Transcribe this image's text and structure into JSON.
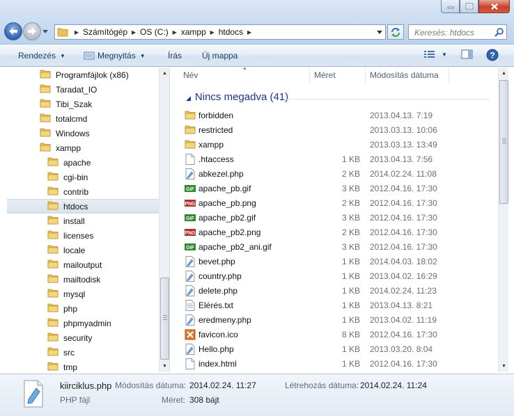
{
  "window": {
    "minimize_icon": "minimize-icon",
    "maximize_icon": "maximize-icon",
    "close_icon": "close-icon"
  },
  "address": {
    "crumbs": [
      "Számítógép",
      "OS (C:)",
      "xampp",
      "htdocs"
    ]
  },
  "search": {
    "placeholder": "Keresés: htdocs"
  },
  "toolbar": {
    "organize": "Rendezés",
    "open": "Megnyitás",
    "burn": "Írás",
    "new_folder": "Új mappa"
  },
  "tree": {
    "items": [
      {
        "label": "Programfájlok (x86)",
        "level": 1
      },
      {
        "label": "Taradat_IO",
        "level": 1
      },
      {
        "label": "Tibi_Szak",
        "level": 1
      },
      {
        "label": "totalcmd",
        "level": 1
      },
      {
        "label": "Windows",
        "level": 1
      },
      {
        "label": "xampp",
        "level": 1
      },
      {
        "label": "apache",
        "level": 2
      },
      {
        "label": "cgi-bin",
        "level": 2
      },
      {
        "label": "contrib",
        "level": 2
      },
      {
        "label": "htdocs",
        "level": 2,
        "selected": true
      },
      {
        "label": "install",
        "level": 2
      },
      {
        "label": "licenses",
        "level": 2
      },
      {
        "label": "locale",
        "level": 2
      },
      {
        "label": "mailoutput",
        "level": 2
      },
      {
        "label": "mailtodisk",
        "level": 2
      },
      {
        "label": "mysql",
        "level": 2
      },
      {
        "label": "php",
        "level": 2
      },
      {
        "label": "phpmyadmin",
        "level": 2
      },
      {
        "label": "security",
        "level": 2
      },
      {
        "label": "src",
        "level": 2
      },
      {
        "label": "tmp",
        "level": 2
      }
    ]
  },
  "list": {
    "columns": {
      "name": "Név",
      "size": "Méret",
      "modified": "Módosítás dátuma"
    },
    "group": "Nincs megadva (41)",
    "rows": [
      {
        "name": "forbidden",
        "size": "",
        "date": "2013.04.13. 7:19",
        "icon": "folder"
      },
      {
        "name": "restricted",
        "size": "",
        "date": "2013.03.13. 10:06",
        "icon": "folder"
      },
      {
        "name": "xampp",
        "size": "",
        "date": "2013.03.13. 13:49",
        "icon": "folder"
      },
      {
        "name": ".htaccess",
        "size": "1 KB",
        "date": "2013.04.13. 7:56",
        "icon": "file"
      },
      {
        "name": "abkezel.php",
        "size": "2 KB",
        "date": "2014.02.24. 11:08",
        "icon": "php"
      },
      {
        "name": "apache_pb.gif",
        "size": "3 KB",
        "date": "2012.04.16. 17:30",
        "icon": "gif"
      },
      {
        "name": "apache_pb.png",
        "size": "2 KB",
        "date": "2012.04.16. 17:30",
        "icon": "png"
      },
      {
        "name": "apache_pb2.gif",
        "size": "3 KB",
        "date": "2012.04.16. 17:30",
        "icon": "gif"
      },
      {
        "name": "apache_pb2.png",
        "size": "2 KB",
        "date": "2012.04.16. 17:30",
        "icon": "png"
      },
      {
        "name": "apache_pb2_ani.gif",
        "size": "3 KB",
        "date": "2012.04.16. 17:30",
        "icon": "gif"
      },
      {
        "name": "bevet.php",
        "size": "1 KB",
        "date": "2014.04.03. 18:02",
        "icon": "php"
      },
      {
        "name": "country.php",
        "size": "1 KB",
        "date": "2013.04.02. 16:29",
        "icon": "php"
      },
      {
        "name": "delete.php",
        "size": "1 KB",
        "date": "2014.02.24. 11:23",
        "icon": "php"
      },
      {
        "name": "Elérés.txt",
        "size": "1 KB",
        "date": "2013.04.13. 8:21",
        "icon": "txt"
      },
      {
        "name": "eredmeny.php",
        "size": "1 KB",
        "date": "2013.04.02. 11:19",
        "icon": "php"
      },
      {
        "name": "favicon.ico",
        "size": "8 KB",
        "date": "2012.04.16. 17:30",
        "icon": "ico"
      },
      {
        "name": "Hello.php",
        "size": "1 KB",
        "date": "2013.03.20. 8:04",
        "icon": "php"
      },
      {
        "name": "index.html",
        "size": "1 KB",
        "date": "2012.04.16. 17:30",
        "icon": "file"
      }
    ]
  },
  "details": {
    "filename": "kiirciklus.php",
    "filetype": "PHP fájl",
    "modified_label": "Módosítás dátuma:",
    "modified_value": "2014.02.24. 11:27",
    "created_label": "Létrehozás dátuma:",
    "created_value": "2014.02.24. 11:24",
    "size_label": "Méret:",
    "size_value": "308 bájt"
  }
}
